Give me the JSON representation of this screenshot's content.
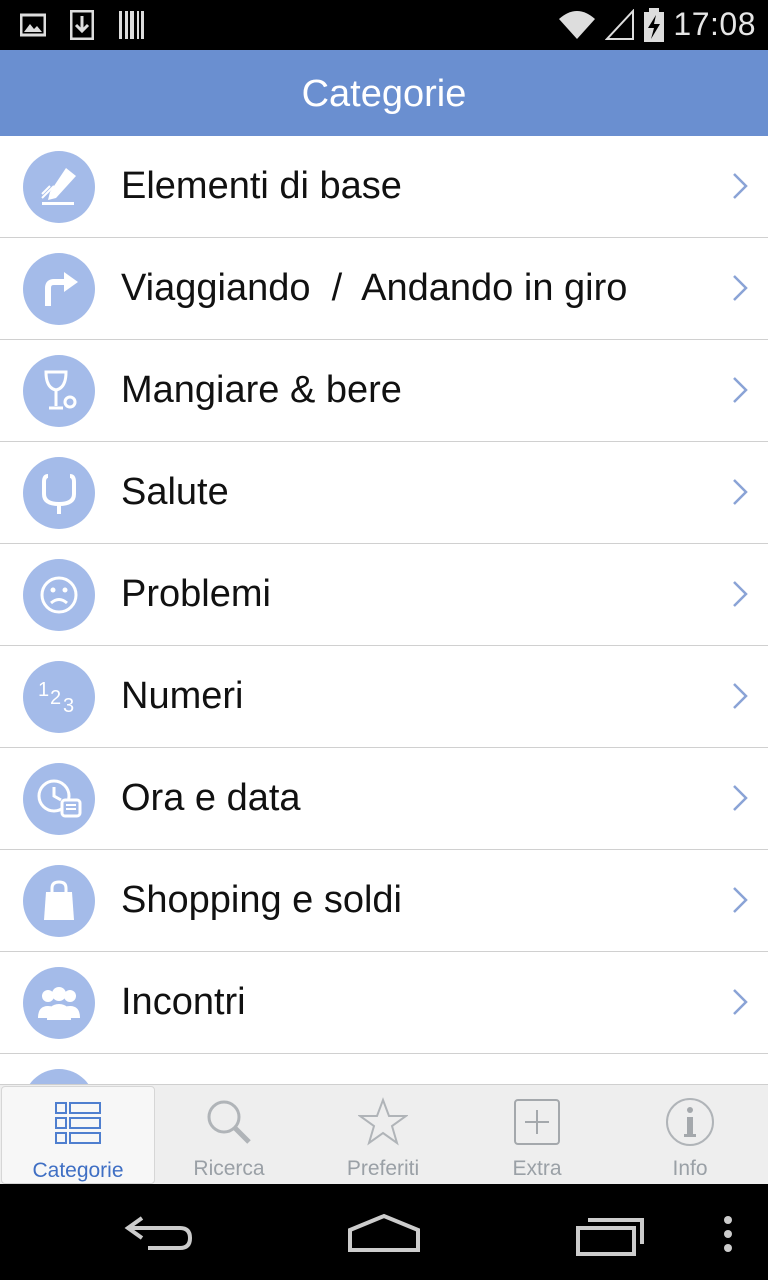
{
  "status_bar": {
    "time": "17:08",
    "icons": [
      "image-icon",
      "download-icon",
      "barcode-icon",
      "wifi-icon",
      "signal-icon",
      "battery-charging-icon"
    ]
  },
  "header": {
    "title": "Categorie"
  },
  "categories": [
    {
      "label": "Elementi di base",
      "icon": "pencil-icon"
    },
    {
      "label": "Viaggiando  /  Andando in giro",
      "icon": "turn-arrow-icon"
    },
    {
      "label": "Mangiare & bere",
      "icon": "glass-icon"
    },
    {
      "label": "Salute",
      "icon": "stethoscope-icon"
    },
    {
      "label": "Problemi",
      "icon": "sad-face-icon"
    },
    {
      "label": "Numeri",
      "icon": "numbers-icon"
    },
    {
      "label": "Ora e data",
      "icon": "clock-icon"
    },
    {
      "label": "Shopping e soldi",
      "icon": "shopping-bag-icon"
    },
    {
      "label": "Incontri",
      "icon": "people-icon"
    }
  ],
  "tabs": [
    {
      "label": "Categorie",
      "icon": "list-icon",
      "active": true
    },
    {
      "label": "Ricerca",
      "icon": "search-icon",
      "active": false
    },
    {
      "label": "Preferiti",
      "icon": "star-icon",
      "active": false
    },
    {
      "label": "Extra",
      "icon": "plus-box-icon",
      "active": false
    },
    {
      "label": "Info",
      "icon": "info-icon",
      "active": false
    }
  ],
  "colors": {
    "header": "#6a8fd0",
    "icon_circle": "#a4bbe9",
    "tab_active": "#3f6fc4",
    "tab_inactive": "#9aa0a6"
  },
  "nav_bar": {
    "icons": [
      "back-icon",
      "home-icon",
      "recent-apps-icon",
      "menu-dots-icon"
    ]
  }
}
